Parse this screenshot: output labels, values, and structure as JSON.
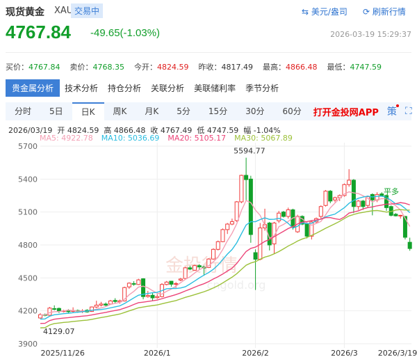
{
  "header": {
    "title": "现货黄金",
    "symbol": "XAU",
    "status": "交易中",
    "unit_link": "美元/盎司",
    "refresh_link": "刷新行情",
    "price": "4767.84",
    "change": "-49.65(-1.03%)",
    "timestamp": "2026-03-19 15:29:37"
  },
  "stats": [
    {
      "label": "买价：",
      "value": "4767.84",
      "color": "#119e2a"
    },
    {
      "label": "卖价：",
      "value": "4768.35",
      "color": "#119e2a"
    },
    {
      "label": "今开：",
      "value": "4824.59",
      "color": "#e02020"
    },
    {
      "label": "昨收：",
      "value": "4817.49",
      "color": "#333333"
    },
    {
      "label": "最高：",
      "value": "4866.48",
      "color": "#e02020"
    },
    {
      "label": "最低：",
      "value": "4747.59",
      "color": "#119e2a"
    }
  ],
  "tabs": [
    "贵金属分析",
    "技术分析",
    "持仓分析",
    "关联分析",
    "美联储利率",
    "季节分析"
  ],
  "periods": [
    "分时",
    "5日",
    "日K",
    "周K",
    "月K",
    "5分",
    "15分",
    "30分",
    "60分"
  ],
  "active_period": "日K",
  "app_link": "打开金投网APP",
  "toolbar_icons": [
    "strategy-icon",
    "fullscreen-icon",
    "more-icon"
  ],
  "strategy_label": "策",
  "info_line": "2026/03/19  开 4824.59  高 4866.48  收 4767.49  低 4747.59  幅 -1.04%",
  "ma_legend": [
    {
      "label": "MA5: 4922.78",
      "color": "#f4a0b5"
    },
    {
      "label": "MA10: 5036.69",
      "color": "#2bbde0"
    },
    {
      "label": "MA20: 5105.17",
      "color": "#ec4478"
    },
    {
      "label": "MA30: 5067.89",
      "color": "#9cc13a"
    }
  ],
  "watermark": {
    "text": "金投行情",
    "url": "cngold.org"
  },
  "chart_data": {
    "type": "candlestick",
    "ylim": [
      3900,
      5700
    ],
    "yticks": [
      3900,
      4200,
      4500,
      4800,
      5100,
      5400,
      5700
    ],
    "xticks": [
      "2025/11/26",
      "2026/1",
      "2026/2",
      "2026/3",
      "2026/3/19"
    ],
    "xtick_index": [
      3,
      25,
      46,
      65,
      78
    ],
    "up_color": "#f03a3a",
    "down_color": "#12a12a",
    "annotations": {
      "max": "5594.77",
      "min": "4129.07",
      "signal": "平多"
    },
    "ohlc": [
      [
        4135,
        4180,
        4129.07,
        4165
      ],
      [
        4165,
        4175,
        4150,
        4160
      ],
      [
        4160,
        4235,
        4155,
        4225
      ],
      [
        4220,
        4250,
        4205,
        4218
      ],
      [
        4222,
        4230,
        4180,
        4198
      ],
      [
        4198,
        4210,
        4185,
        4200
      ],
      [
        4200,
        4215,
        4180,
        4192
      ],
      [
        4195,
        4232,
        4185,
        4203
      ],
      [
        4203,
        4212,
        4182,
        4196
      ],
      [
        4192,
        4215,
        4180,
        4200
      ],
      [
        4205,
        4215,
        4183,
        4190
      ],
      [
        4195,
        4240,
        4190,
        4235
      ],
      [
        4235,
        4292,
        4225,
        4252
      ],
      [
        4252,
        4282,
        4240,
        4262
      ],
      [
        4262,
        4276,
        4240,
        4252
      ],
      [
        4262,
        4300,
        4255,
        4290
      ],
      [
        4295,
        4315,
        4270,
        4285
      ],
      [
        4282,
        4302,
        4265,
        4292
      ],
      [
        4290,
        4420,
        4285,
        4412
      ],
      [
        4418,
        4460,
        4400,
        4452
      ],
      [
        4448,
        4470,
        4428,
        4446
      ],
      [
        4440,
        4492,
        4435,
        4482
      ],
      [
        4492,
        4497,
        4305,
        4330
      ],
      [
        4330,
        4382,
        4320,
        4340
      ],
      [
        4342,
        4362,
        4295,
        4318
      ],
      [
        4320,
        4352,
        4310,
        4330
      ],
      [
        4330,
        4452,
        4322,
        4440
      ],
      [
        4440,
        4472,
        4432,
        4462
      ],
      [
        4470,
        4472,
        4420,
        4442
      ],
      [
        4445,
        4462,
        4410,
        4448
      ],
      [
        4480,
        4500,
        4470,
        4490
      ],
      [
        4495,
        4600,
        4490,
        4592
      ],
      [
        4592,
        4612,
        4570,
        4580
      ],
      [
        4570,
        4620,
        4565,
        4612
      ],
      [
        4612,
        4625,
        4575,
        4600
      ],
      [
        4600,
        4612,
        4520,
        4590
      ],
      [
        4595,
        4680,
        4590,
        4672
      ],
      [
        4672,
        4770,
        4665,
        4760
      ],
      [
        4760,
        4840,
        4750,
        4830
      ],
      [
        4830,
        4950,
        4825,
        4940
      ],
      [
        4940,
        5000,
        4900,
        4990
      ],
      [
        4990,
        5040,
        4980,
        5012
      ],
      [
        5022,
        5200,
        5010,
        5193
      ],
      [
        5193,
        5440,
        5180,
        5434
      ],
      [
        5434,
        5594.77,
        5200,
        5395
      ],
      [
        5400,
        5430,
        4820,
        4895
      ],
      [
        4730,
        4760,
        4390,
        4670
      ],
      [
        4670,
        5000,
        4660,
        4955
      ],
      [
        4955,
        5130,
        4930,
        4985
      ],
      [
        5000,
        5010,
        4750,
        4800
      ],
      [
        4810,
        5010,
        4720,
        5000
      ],
      [
        5020,
        5110,
        5000,
        5090
      ],
      [
        5100,
        5110,
        5050,
        5060
      ],
      [
        5060,
        5140,
        5040,
        5120
      ],
      [
        5120,
        5130,
        4940,
        4960
      ],
      [
        4920,
        5075,
        4910,
        5060
      ],
      [
        5060,
        5070,
        4980,
        4990
      ],
      [
        4990,
        5000,
        4860,
        4880
      ],
      [
        4880,
        5020,
        4850,
        5010
      ],
      [
        5010,
        5050,
        5000,
        5040
      ],
      [
        5060,
        5160,
        5040,
        5150
      ],
      [
        5160,
        5300,
        5150,
        5290
      ],
      [
        5290,
        5300,
        5180,
        5200
      ],
      [
        5210,
        5240,
        5190,
        5230
      ],
      [
        5230,
        5260,
        5200,
        5250
      ],
      [
        5250,
        5360,
        5240,
        5350
      ],
      [
        5350,
        5490,
        5330,
        5390
      ],
      [
        5390,
        5400,
        5090,
        5150
      ],
      [
        5150,
        5210,
        5120,
        5200
      ],
      [
        5200,
        5210,
        5120,
        5150
      ],
      [
        5160,
        5250,
        5140,
        5240
      ],
      [
        5260,
        5270,
        5070,
        5210
      ],
      [
        5210,
        5280,
        5190,
        5260
      ],
      [
        5265,
        5280,
        5240,
        5250
      ],
      [
        5250,
        5260,
        5110,
        5140
      ],
      [
        5150,
        5160,
        5060,
        5070
      ],
      [
        5080,
        5090,
        5060,
        5065
      ],
      [
        5065,
        5075,
        5040,
        5070
      ],
      [
        5060,
        5065,
        4850,
        4870
      ],
      [
        4824.59,
        4866.48,
        4747.59,
        4767.49
      ]
    ]
  }
}
